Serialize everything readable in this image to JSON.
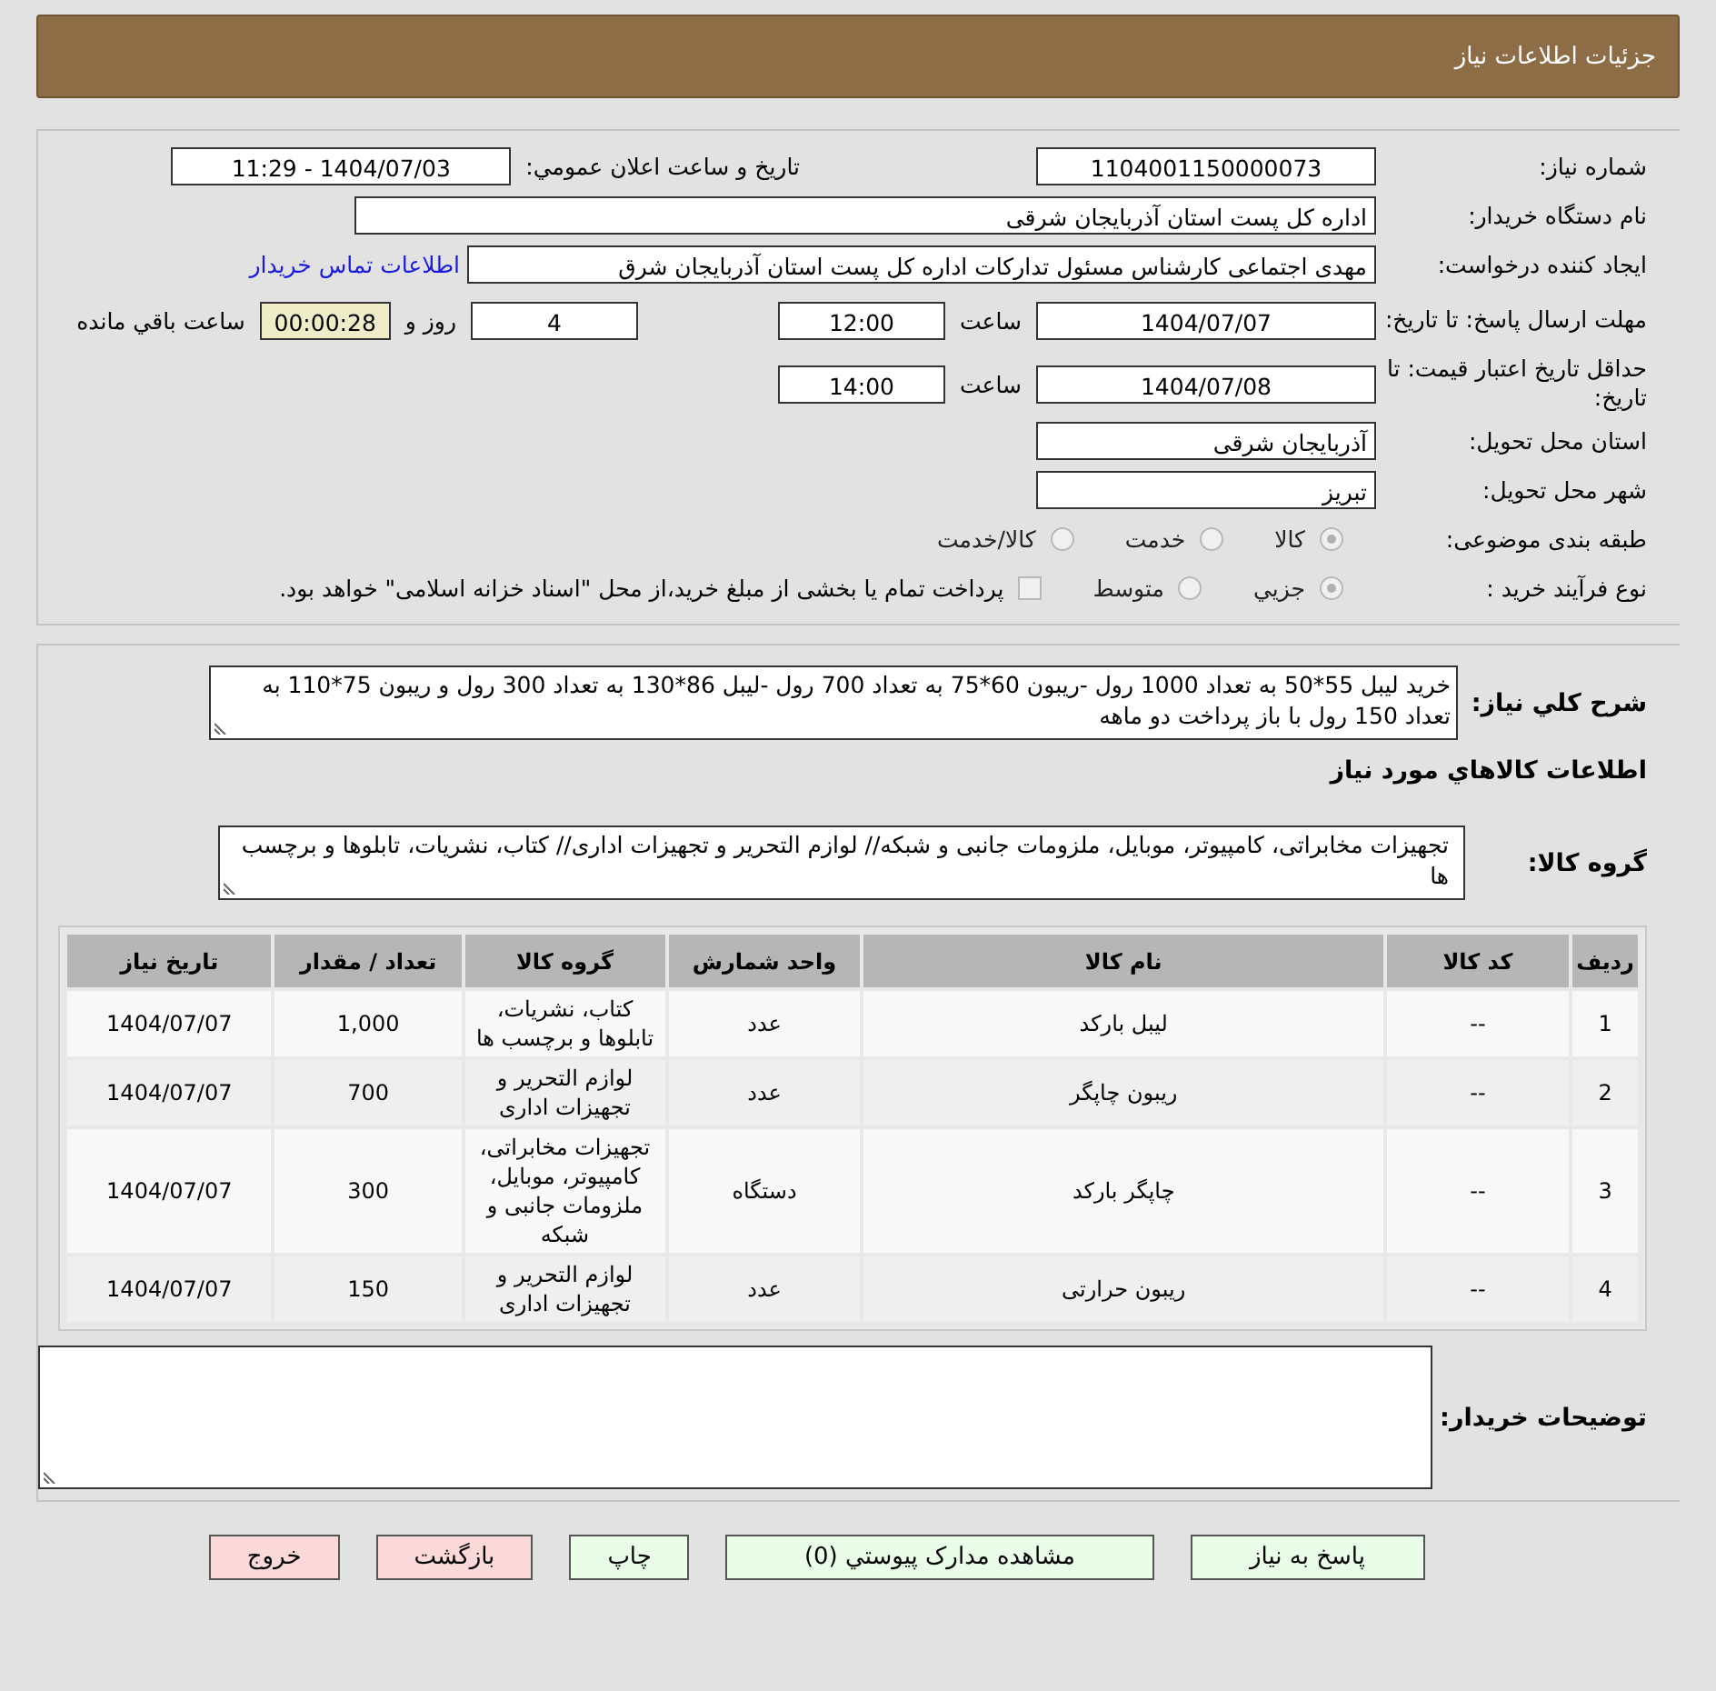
{
  "header": {
    "title": "جزئیات اطلاعات نیاز"
  },
  "need_number": {
    "label": "شماره نیاز:",
    "value": "1104001150000073"
  },
  "announce": {
    "label": "تاریخ و ساعت اعلان عمومي:",
    "value": "1404/07/03 - 11:29"
  },
  "buyer": {
    "label": "نام دستگاه خریدار:",
    "value": "اداره کل پست استان آذربایجان شرقی"
  },
  "requester": {
    "label": "ایجاد کننده درخواست:",
    "value": "مهدی اجتماعی کارشناس مسئول تدارکات اداره کل پست استان آذربایجان شرق",
    "link": "اطلاعات تماس خریدار"
  },
  "deadline": {
    "label": "مهلت ارسال پاسخ: تا تاریخ:",
    "date": "1404/07/07",
    "time_label": "ساعت",
    "time": "12:00",
    "days": "4",
    "days_label": "روز و",
    "remaining": "00:00:28",
    "remaining_label": "ساعت باقي مانده"
  },
  "validity": {
    "label": "حداقل تاریخ اعتبار قیمت: تا تاریخ:",
    "date": "1404/07/08",
    "time_label": "ساعت",
    "time": "14:00"
  },
  "province": {
    "label": "استان محل تحویل:",
    "value": "آذربایجان شرقی"
  },
  "city": {
    "label": "شهر محل تحویل:",
    "value": "تبریز"
  },
  "category": {
    "label": "طبقه بندی موضوعی:",
    "options": [
      {
        "label": "كالا",
        "selected": true
      },
      {
        "label": "خدمت",
        "selected": false
      },
      {
        "label": "كالا/خدمت",
        "selected": false
      }
    ]
  },
  "purchase_type": {
    "label": "نوع فرآیند خرید :",
    "options": [
      {
        "label": "جزيي",
        "selected": true
      },
      {
        "label": "متوسط",
        "selected": false
      }
    ],
    "payment": {
      "label": "پرداخت تمام یا بخشی از مبلغ خرید،از محل \"اسناد خزانه اسلامی\" خواهد بود.",
      "checked": false
    }
  },
  "description": {
    "label": "شرح كلي نياز:",
    "value": "خرید لیبل 55*50 به تعداد 1000 رول -ریبون 60*75 به تعداد 700 رول -لیبل 86*130 به تعداد 300 رول و ریبون 75*110 به تعداد 150 رول  با باز پرداخت دو ماهه"
  },
  "goods_heading": "اطلاعات كالاهاي مورد نياز",
  "goods_group": {
    "label": "گروه كالا:",
    "value": "تجهیزات مخابراتی، کامپیوتر، موبایل، ملزومات جانبی و شبکه// لوازم التحریر و تجهیزات اداری// کتاب، نشریات، تابلوها و برچسب ها"
  },
  "table": {
    "columns": [
      "ردیف",
      "کد کالا",
      "نام کالا",
      "واحد شمارش",
      "گروه کالا",
      "تعداد / مقدار",
      "تاریخ نیاز"
    ],
    "rows": [
      [
        "1",
        "--",
        "لیبل بارکد",
        "عدد",
        "کتاب، نشریات، تابلوها و برچسب ها",
        "1,000",
        "1404/07/07"
      ],
      [
        "2",
        "--",
        "ریبون چاپگر",
        "عدد",
        "لوازم التحریر و تجهیزات اداری",
        "700",
        "1404/07/07"
      ],
      [
        "3",
        "--",
        "چاپگر بارکد",
        "دستگاه",
        "تجهیزات مخابراتی، کامپیوتر، موبایل، ملزومات جانبی و شبکه",
        "300",
        "1404/07/07"
      ],
      [
        "4",
        "--",
        "ریبون حرارتی",
        "عدد",
        "لوازم التحریر و تجهیزات اداری",
        "150",
        "1404/07/07"
      ]
    ]
  },
  "notes": {
    "label": "توضیحات خریدار:"
  },
  "buttons": [
    {
      "label": "پاسخ به نیاز",
      "kind": "green"
    },
    {
      "label": "مشاهده مدارک پیوستي (0)",
      "kind": "green"
    },
    {
      "label": "چاپ",
      "kind": "green"
    },
    {
      "label": "بازگشت",
      "kind": "red"
    },
    {
      "label": "خروج",
      "kind": "red"
    }
  ]
}
